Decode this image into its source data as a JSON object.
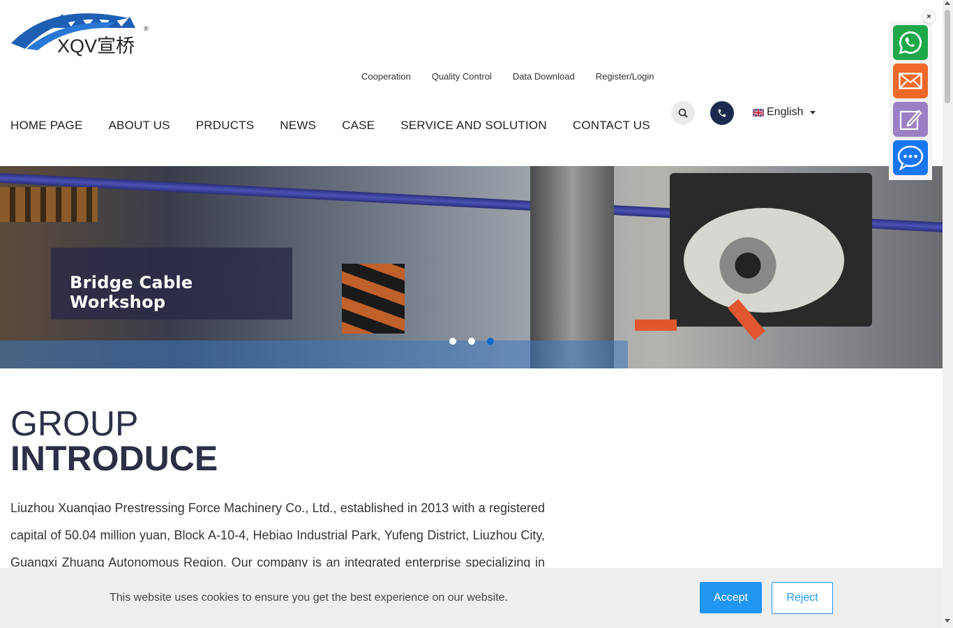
{
  "logo": {
    "text": "XQV宣桥",
    "registered": "®"
  },
  "topnav": [
    "Cooperation",
    "Quality Control",
    "Data Download",
    "Register/Login"
  ],
  "mainnav": [
    "HOME PAGE",
    "ABOUT US",
    "PRDUCTS",
    "NEWS",
    "CASE",
    "SERVICE AND SOLUTION",
    "CONTACT US"
  ],
  "language": {
    "selected": "English"
  },
  "float": {
    "close": "×",
    "icons": [
      "whatsapp-icon",
      "mail-icon",
      "edit-form-icon",
      "chat-icon"
    ]
  },
  "hero": {
    "caption": "Bridge Cable Workshop",
    "slides": 3,
    "active_slide": 3
  },
  "intro": {
    "title_light": "GROUP",
    "title_bold": "INTRODUCE",
    "paragraph": "Liuzhou Xuanqiao Prestressing Force Machinery Co., Ltd., established in 2013 with a registered capital of 50.04 million yuan, Block A-10-4, Hebiao Industrial Park, Yufeng District, Liuzhou City, Guangxi Zhuang Autonomous Region. Our company is an integrated enterprise specializing in"
  },
  "cookie": {
    "message": "This website uses cookies to ensure you get the best experience on our website.",
    "accept": "Accept",
    "reject": "Reject"
  },
  "colors": {
    "accent": "#2196f3",
    "dark_navy": "#1b2a4e",
    "heading": "#2c2f45",
    "active_dot": "#0a6bcb"
  }
}
